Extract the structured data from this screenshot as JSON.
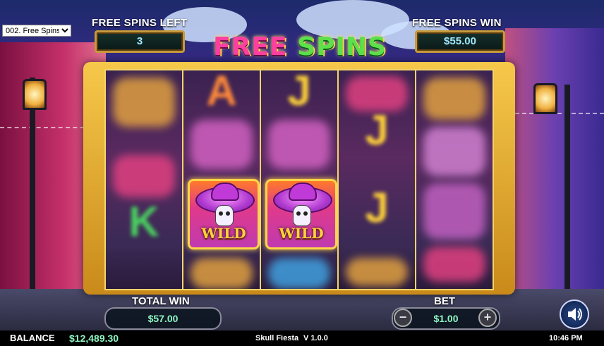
{
  "debug_dropdown": {
    "selected": "002. Free Spins"
  },
  "meters": {
    "spins_left_label": "FREE SPINS LEFT",
    "spins_left_value": "3",
    "spins_win_label": "FREE SPINS WIN",
    "spins_win_value": "$55.00"
  },
  "logo": {
    "word1": "FREE",
    "word2": "SPINS"
  },
  "reels": [
    {
      "blur_symbols": [
        "♥",
        "K"
      ],
      "wild": false
    },
    {
      "blur_symbols": [
        "A"
      ],
      "wild": true
    },
    {
      "blur_symbols": [
        "J"
      ],
      "wild": true
    },
    {
      "blur_symbols": [
        "J",
        "J"
      ],
      "wild": false
    },
    {
      "blur_symbols": [
        "♦"
      ],
      "wild": false
    }
  ],
  "wild_label": "WILD",
  "bottom": {
    "total_win_label": "TOTAL WIN",
    "total_win_value": "$57.00",
    "bet_label": "BET",
    "bet_value": "$1.00",
    "minus": "−",
    "plus": "+"
  },
  "status": {
    "balance_label": "BALANCE",
    "balance_value": "$12,489.30",
    "game_name": "Skull Fiesta",
    "version": "V 1.0.0",
    "time": "10:46 PM"
  },
  "colors": {
    "gold": "#f3d56a",
    "pink": "#ff3fa0",
    "green": "#5de04a",
    "win_text": "#8ef6c0"
  }
}
